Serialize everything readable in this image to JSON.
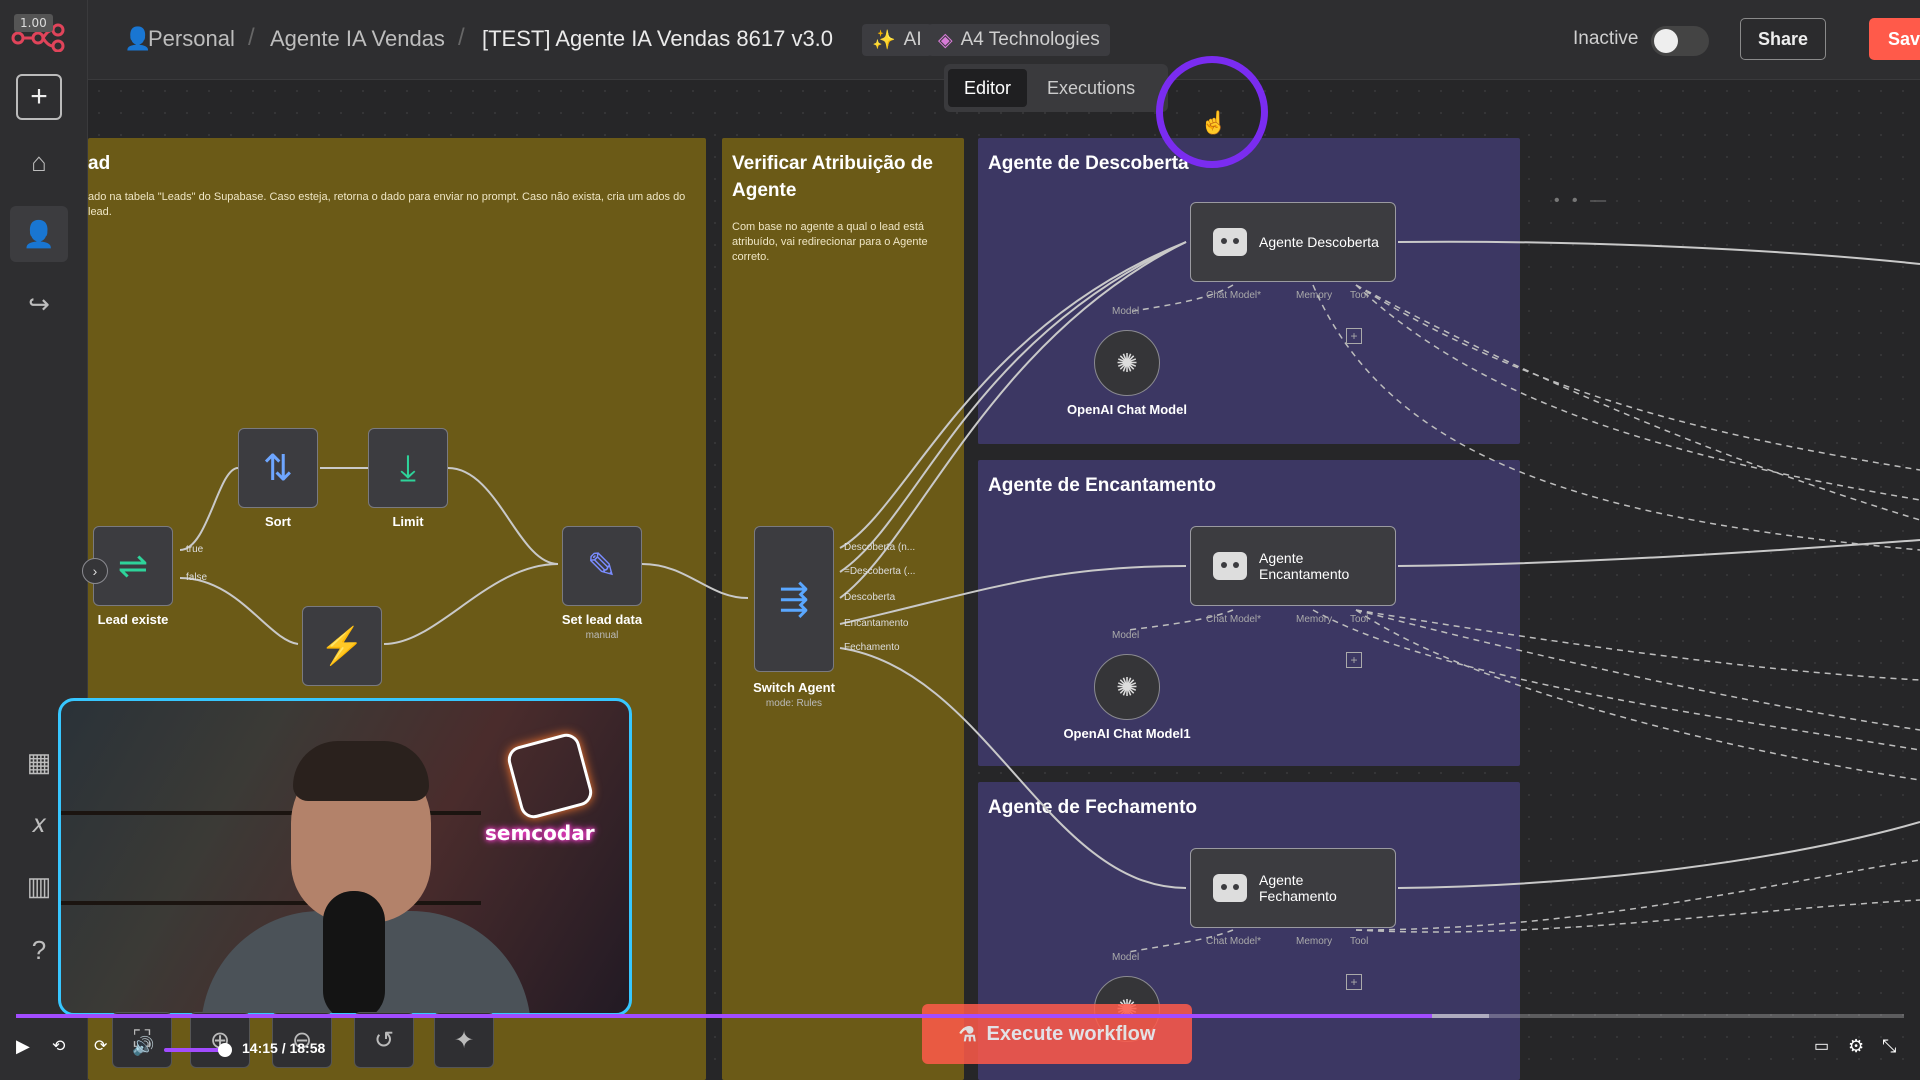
{
  "zoom_badge": "1.00",
  "breadcrumb": {
    "personal": "Personal",
    "project": "Agente IA Vendas",
    "workflow": "[TEST] Agente IA Vendas 8617 v3.0"
  },
  "tags": [
    {
      "icon": "sparkles-icon",
      "label": "AI"
    },
    {
      "icon": "tag-icon",
      "label": "A4 Technologies"
    }
  ],
  "status": {
    "label": "Inactive",
    "active": false
  },
  "share_label": "Share",
  "save_label": "Save",
  "tabs": [
    {
      "label": "Editor",
      "active": true
    },
    {
      "label": "Executions",
      "active": false
    }
  ],
  "groups": {
    "lead": {
      "title": "ad",
      "desc": "ado na tabela \"Leads\" do Supabase. Caso esteja, retorna o dado para enviar no prompt. Caso não exista, cria um ados do lead."
    },
    "verify": {
      "title": "Verificar Atribuição de Agente",
      "desc": "Com base no agente a qual o lead está atribuído, vai redirecionar para o Agente correto."
    },
    "descoberta": {
      "title": "Agente de Descoberta"
    },
    "encantamento": {
      "title": "Agente de Encantamento"
    },
    "fechamento": {
      "title": "Agente de Fechamento"
    }
  },
  "nodes": {
    "lead_existe": {
      "label": "Lead existe",
      "out_true": "true",
      "out_false": "false"
    },
    "sort": {
      "label": "Sort"
    },
    "limit": {
      "label": "Limit"
    },
    "set_lead": {
      "label": "Set lead data",
      "sub": "manual"
    },
    "switch": {
      "label": "Switch Agent",
      "sub": "mode: Rules",
      "outputs": [
        "Descoberta (n...",
        "=Descoberta (...",
        "Descoberta",
        "Encantamento",
        "Fechamento"
      ]
    },
    "agente_descoberta": {
      "label": "Agente Descoberta"
    },
    "agente_encantamento": {
      "label": "Agente Encantamento"
    },
    "agente_fechamento": {
      "label": "Agente Fechamento"
    },
    "openai_1": {
      "label": "OpenAI Chat Model"
    },
    "openai_2": {
      "label": "OpenAI Chat Model1"
    }
  },
  "agent_ports": {
    "chat_model": "Chat Model*",
    "memory": "Memory",
    "tool": "Tool",
    "model": "Model"
  },
  "webcam": {
    "brand": "semcodar"
  },
  "video": {
    "time": "14:15 / 18:58",
    "progress": 0.75
  },
  "execute_label": "Execute workflow",
  "colors": {
    "accent": "#ff5a4a",
    "group_olive": "#6b5a17",
    "group_purple": "#3c3763",
    "progress": "#a24cff"
  }
}
